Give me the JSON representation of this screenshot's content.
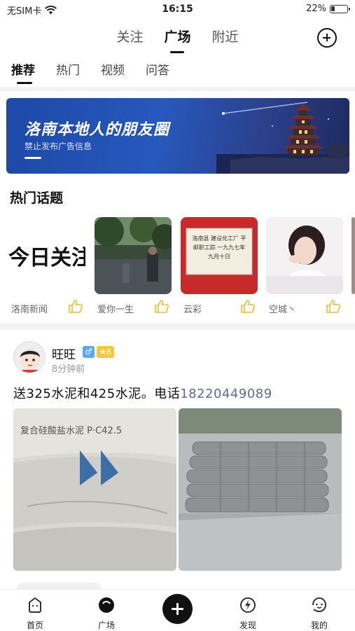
{
  "status": {
    "carrier": "无SIM卡",
    "time": "16:15",
    "battery": "22%",
    "battery_level": 0.22
  },
  "top_tabs": [
    {
      "label": "关注"
    },
    {
      "label": "广场"
    },
    {
      "label": "附近"
    }
  ],
  "sub_tabs": [
    {
      "label": "推荐"
    },
    {
      "label": "热门"
    },
    {
      "label": "视频"
    },
    {
      "label": "问答"
    }
  ],
  "banner": {
    "title": "洛南本地人的朋友圈",
    "subtitle": "禁止发布广告信息"
  },
  "hot_topics": {
    "title": "热门话题",
    "items": [
      {
        "name": "洛南新闻",
        "image_text": "今日关注"
      },
      {
        "name": "爱你一生"
      },
      {
        "name": "云彩",
        "image_text": "洛南县 建设化工厂 平邮职工踪 一九九七年九月十日"
      },
      {
        "name": "空城丶"
      }
    ]
  },
  "post": {
    "username": "旺旺",
    "gender": "♂",
    "level": "★8",
    "time": "8分钟前",
    "text": "送325水泥和425水泥。电话",
    "phone": "18220449089",
    "image1_text": "复合硅酸盐水泥 P·C42.5"
  },
  "bottom_nav": [
    {
      "label": "首页",
      "icon": "home-icon"
    },
    {
      "label": "广场",
      "icon": "square-icon"
    },
    {
      "label": "发现",
      "icon": "discover-icon"
    },
    {
      "label": "我的",
      "icon": "profile-icon"
    }
  ],
  "colors": {
    "accent": "#111111",
    "banner": "#2758bd",
    "link": "#5a6d92",
    "level_badge": "#f6c93a",
    "gender_badge": "#5aa9ef"
  }
}
